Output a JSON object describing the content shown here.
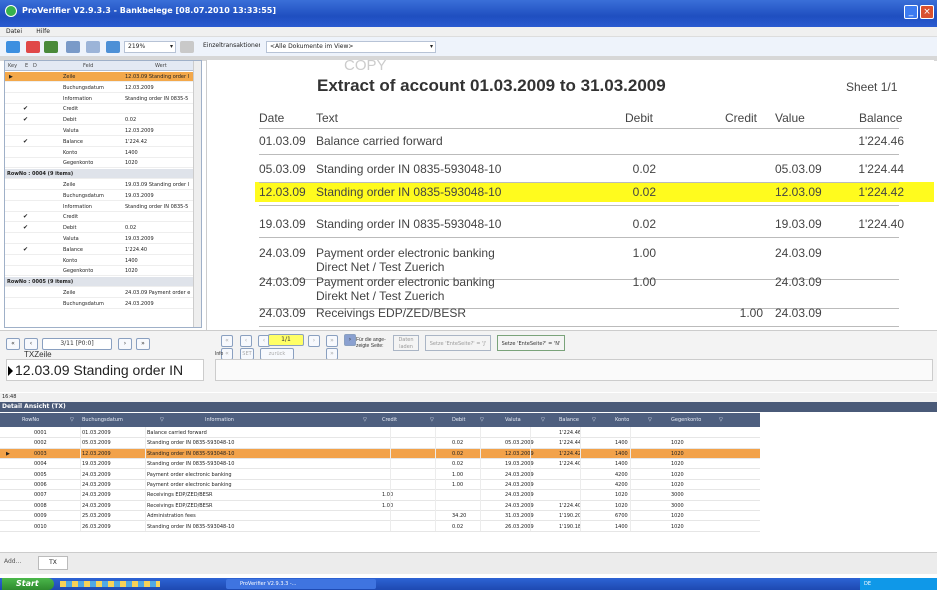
{
  "window": {
    "title": "ProVerifier V2.9.3.3 - Bankbelege [08.07.2010 13:33:55]"
  },
  "menu": [
    "Datei",
    "Hilfe"
  ],
  "toolbar": {
    "zoom": "219%",
    "mode": "Einzeltransaktionen",
    "filter": "<Alle Dokumente im View>"
  },
  "left_panel": {
    "columns": [
      "Key",
      "E",
      "D",
      "Feld",
      "Wert"
    ],
    "rows": [
      {
        "type": "row",
        "chk": "",
        "field": "Zeile",
        "value": "12.03.09 Standing order I",
        "selected": true
      },
      {
        "type": "row",
        "chk": "",
        "field": "Buchungsdatum",
        "value": "12.03.2009"
      },
      {
        "type": "row",
        "chk": "",
        "field": "Information",
        "value": "Standing order IN 0835-5"
      },
      {
        "type": "row",
        "chk": "✔",
        "field": "Credit",
        "value": ""
      },
      {
        "type": "row",
        "chk": "✔",
        "field": "Debit",
        "value": "0.02"
      },
      {
        "type": "row",
        "chk": "",
        "field": "Valuta",
        "value": "12.03.2009"
      },
      {
        "type": "row",
        "chk": "✔",
        "field": "Balance",
        "value": "1'224.42"
      },
      {
        "type": "row",
        "chk": "",
        "field": "Konto",
        "value": "1400"
      },
      {
        "type": "row",
        "chk": "",
        "field": "Gegenkonto",
        "value": "1020"
      },
      {
        "type": "group",
        "label": "RowNo : 0004 (9 items)"
      },
      {
        "type": "row",
        "chk": "",
        "field": "Zeile",
        "value": "19.03.09 Standing order I"
      },
      {
        "type": "row",
        "chk": "",
        "field": "Buchungsdatum",
        "value": "19.03.2009"
      },
      {
        "type": "row",
        "chk": "",
        "field": "Information",
        "value": "Standing order IN 0835-5"
      },
      {
        "type": "row",
        "chk": "✔",
        "field": "Credit",
        "value": ""
      },
      {
        "type": "row",
        "chk": "✔",
        "field": "Debit",
        "value": "0.02"
      },
      {
        "type": "row",
        "chk": "",
        "field": "Valuta",
        "value": "19.03.2009"
      },
      {
        "type": "row",
        "chk": "✔",
        "field": "Balance",
        "value": "1'224.40"
      },
      {
        "type": "row",
        "chk": "",
        "field": "Konto",
        "value": "1400"
      },
      {
        "type": "row",
        "chk": "",
        "field": "Gegenkonto",
        "value": "1020"
      },
      {
        "type": "group",
        "label": "RowNo : 0005 (9 items)"
      },
      {
        "type": "row",
        "chk": "",
        "field": "Zeile",
        "value": "24.03.09 Payment order e"
      },
      {
        "type": "row",
        "chk": "",
        "field": "Buchungsdatum",
        "value": "24.03.2009"
      }
    ]
  },
  "document": {
    "stamp": "COPY",
    "heading": "Extract of account 01.03.2009 to 31.03.2009",
    "sheet": "Sheet 1/1",
    "columns": {
      "date": "Date",
      "text": "Text",
      "debit": "Debit",
      "credit": "Credit",
      "value": "Value",
      "balance": "Balance"
    },
    "lines": [
      {
        "date": "01.03.09",
        "text": "Balance carried forward",
        "text2": "",
        "debit": "",
        "credit": "",
        "value": "",
        "balance": "1'224.46"
      },
      {
        "date": "05.03.09",
        "text": "Standing order IN 0835-593048-10",
        "text2": "",
        "debit": "0.02",
        "credit": "",
        "value": "05.03.09",
        "balance": "1'224.44"
      },
      {
        "date": "12.03.09",
        "text": "Standing order IN 0835-593048-10",
        "text2": "",
        "debit": "0.02",
        "credit": "",
        "value": "12.03.09",
        "balance": "1'224.42"
      },
      {
        "date": "19.03.09",
        "text": "Standing order IN 0835-593048-10",
        "text2": "",
        "debit": "0.02",
        "credit": "",
        "value": "19.03.09",
        "balance": "1'224.40"
      },
      {
        "date": "24.03.09",
        "text": "Payment order electronic banking",
        "text2": "Direct Net / Test Zuerich",
        "debit": "1.00",
        "credit": "",
        "value": "24.03.09",
        "balance": ""
      },
      {
        "date": "24.03.09",
        "text": "Payment order electronic banking",
        "text2": "Direkt Net / Test Zuerich",
        "debit": "1.00",
        "credit": "",
        "value": "24.03.09",
        "balance": ""
      },
      {
        "date": "24.03.09",
        "text": "Receivings EDP/ZED/BESR",
        "text2": "",
        "debit": "",
        "credit": "1.00",
        "value": "24.03.09",
        "balance": ""
      }
    ]
  },
  "navigator": {
    "position": "3/11 [P0:0]",
    "page": "1/1",
    "btn_set": "SET",
    "btn_back": "zurück",
    "for_page": "Für die ange-zeigte Seite:",
    "btn_load": "Daten laden",
    "btn_set2": "Setze 'EnteSeite?' = 'J'",
    "btn_set3": "Setze 'EnteSeite?' = 'N'",
    "txzeile_label": "TXZeile",
    "txzeile_value": "12.03.09 Standing order IN",
    "info_label": "Info"
  },
  "status": {
    "time": "16:48"
  },
  "detail": {
    "title": "Detail Ansicht (TX)",
    "columns": [
      "RowNo",
      "Buchungsdatum",
      "Information",
      "Credit",
      "Debit",
      "Valuta",
      "Balance",
      "Konto",
      "Gegenkonto"
    ],
    "rows": [
      [
        "0001",
        "01.03.2009",
        "Balance carried forward",
        "",
        "",
        "",
        "1'224.46",
        "",
        ""
      ],
      [
        "0002",
        "05.03.2009",
        "Standing order IN 0835-593048-10",
        "",
        "0.02",
        "05.03.2009",
        "1'224.44",
        "1400",
        "1020"
      ],
      [
        "0003",
        "12.03.2009",
        "Standing order IN 0835-593048-10",
        "",
        "0.02",
        "12.03.2009",
        "1'224.42",
        "1400",
        "1020"
      ],
      [
        "0004",
        "19.03.2009",
        "Standing order IN 0835-593048-10",
        "",
        "0.02",
        "19.03.2009",
        "1'224.40",
        "1400",
        "1020"
      ],
      [
        "0005",
        "24.03.2009",
        "Payment order electronic banking",
        "",
        "1.00",
        "24.03.2009",
        "",
        "4200",
        "1020"
      ],
      [
        "0006",
        "24.03.2009",
        "Payment order electronic banking",
        "",
        "1.00",
        "24.03.2009",
        "",
        "4200",
        "1020"
      ],
      [
        "0007",
        "24.03.2009",
        "Receivings EDP/ZED/BESR",
        "1.00",
        "",
        "24.03.2009",
        "",
        "1020",
        "3000"
      ],
      [
        "0008",
        "24.03.2009",
        "Receivings EDP/ZED/BESR",
        "1.00",
        "",
        "24.03.2009",
        "1'224.40",
        "1020",
        "3000"
      ],
      [
        "0009",
        "25.03.2009",
        "Administration fees",
        "",
        "34.20",
        "31.03.2009",
        "1'190.20",
        "6700",
        "1020"
      ],
      [
        "0010",
        "26.03.2009",
        "Standing order IN 0835-593048-10",
        "",
        "0.02",
        "26.03.2009",
        "1'190.18",
        "1400",
        "1020"
      ]
    ],
    "selected_row": 2
  },
  "bottom_tabs": [
    "Add...",
    "TX"
  ],
  "taskbar": {
    "start": "Start",
    "task": "ProVerifier V2.9.3.3 -...",
    "tray": "DE"
  }
}
